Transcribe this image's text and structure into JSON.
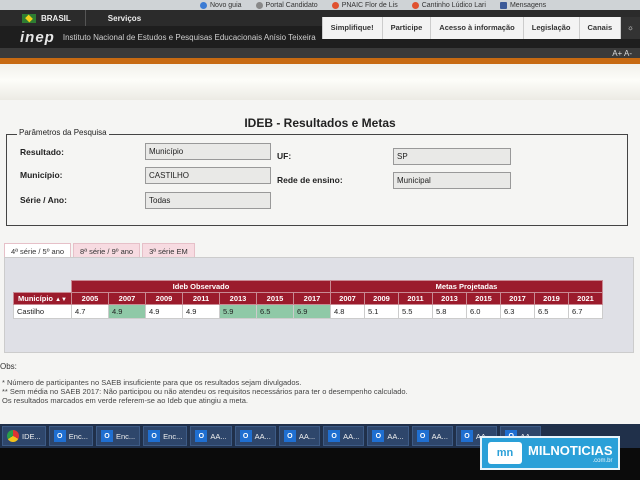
{
  "bookmarks": [
    "Novo guia",
    "Portal Candidato",
    "PNAIC Flor de Lis",
    "Cantinho Lúdico Lari",
    "Mensagens"
  ],
  "govbar": {
    "brasil": "BRASIL",
    "servicos": "Serviços"
  },
  "inep": {
    "logo": "inep",
    "name": "Instituto Nacional de Estudos e Pesquisas Educacionais Anísio Teixeira",
    "nav": [
      "Simplifique!",
      "Participe",
      "Acesso à informação",
      "Legislação",
      "Canais"
    ],
    "font_controls": "A+ A-"
  },
  "page": {
    "title": "IDEB - Resultados e Metas",
    "params_legend": "Parâmetros da Pesquisa",
    "fields": {
      "resultado": {
        "label": "Resultado:",
        "value": "Município"
      },
      "municipio": {
        "label": "Município:",
        "value": "CASTILHO"
      },
      "serie": {
        "label": "Série / Ano:",
        "value": "Todas"
      },
      "uf": {
        "label": "UF:",
        "value": "SP"
      },
      "rede": {
        "label": "Rede de ensino:",
        "value": "Municipal"
      }
    },
    "tabs": [
      "4ª série / 5º ano",
      "8ª série / 9º ano",
      "3ª série EM"
    ],
    "table": {
      "group_observed": "Ideb Observado",
      "group_projected": "Metas Projetadas",
      "col_municipio": "Município",
      "observed_years": [
        "2005",
        "2007",
        "2009",
        "2011",
        "2013",
        "2015",
        "2017"
      ],
      "projected_years": [
        "2007",
        "2009",
        "2011",
        "2013",
        "2015",
        "2017",
        "2019",
        "2021"
      ],
      "row_name": "Castilho",
      "observed": [
        "4.7",
        "4.9",
        "4.9",
        "4.9",
        "5.9",
        "6.5",
        "6.9"
      ],
      "projected": [
        "4.8",
        "5.1",
        "5.5",
        "5.8",
        "6.0",
        "6.3",
        "6.5",
        "6.7"
      ],
      "highlight_color": "#8fc9a7"
    },
    "obs_title": "Obs:",
    "notes": [
      "* Número de participantes no SAEB insuficiente para que os resultados sejam divulgados.",
      "** Sem média no SAEB 2017: Não participou ou não atendeu os requisitos necessários para ter o desempenho calculado.",
      "Os resultados marcados em verde referem-se ao Ideb que atingiu a meta."
    ]
  },
  "taskbar": {
    "items": [
      "IDE...",
      "Enc...",
      "Enc...",
      "Enc...",
      "AA...",
      "AA...",
      "AA...",
      "AA...",
      "AA...",
      "AA...",
      "AA...",
      "AA..."
    ]
  },
  "watermark": {
    "text": "MILNOTICIAS",
    "sub": ".com.br"
  }
}
